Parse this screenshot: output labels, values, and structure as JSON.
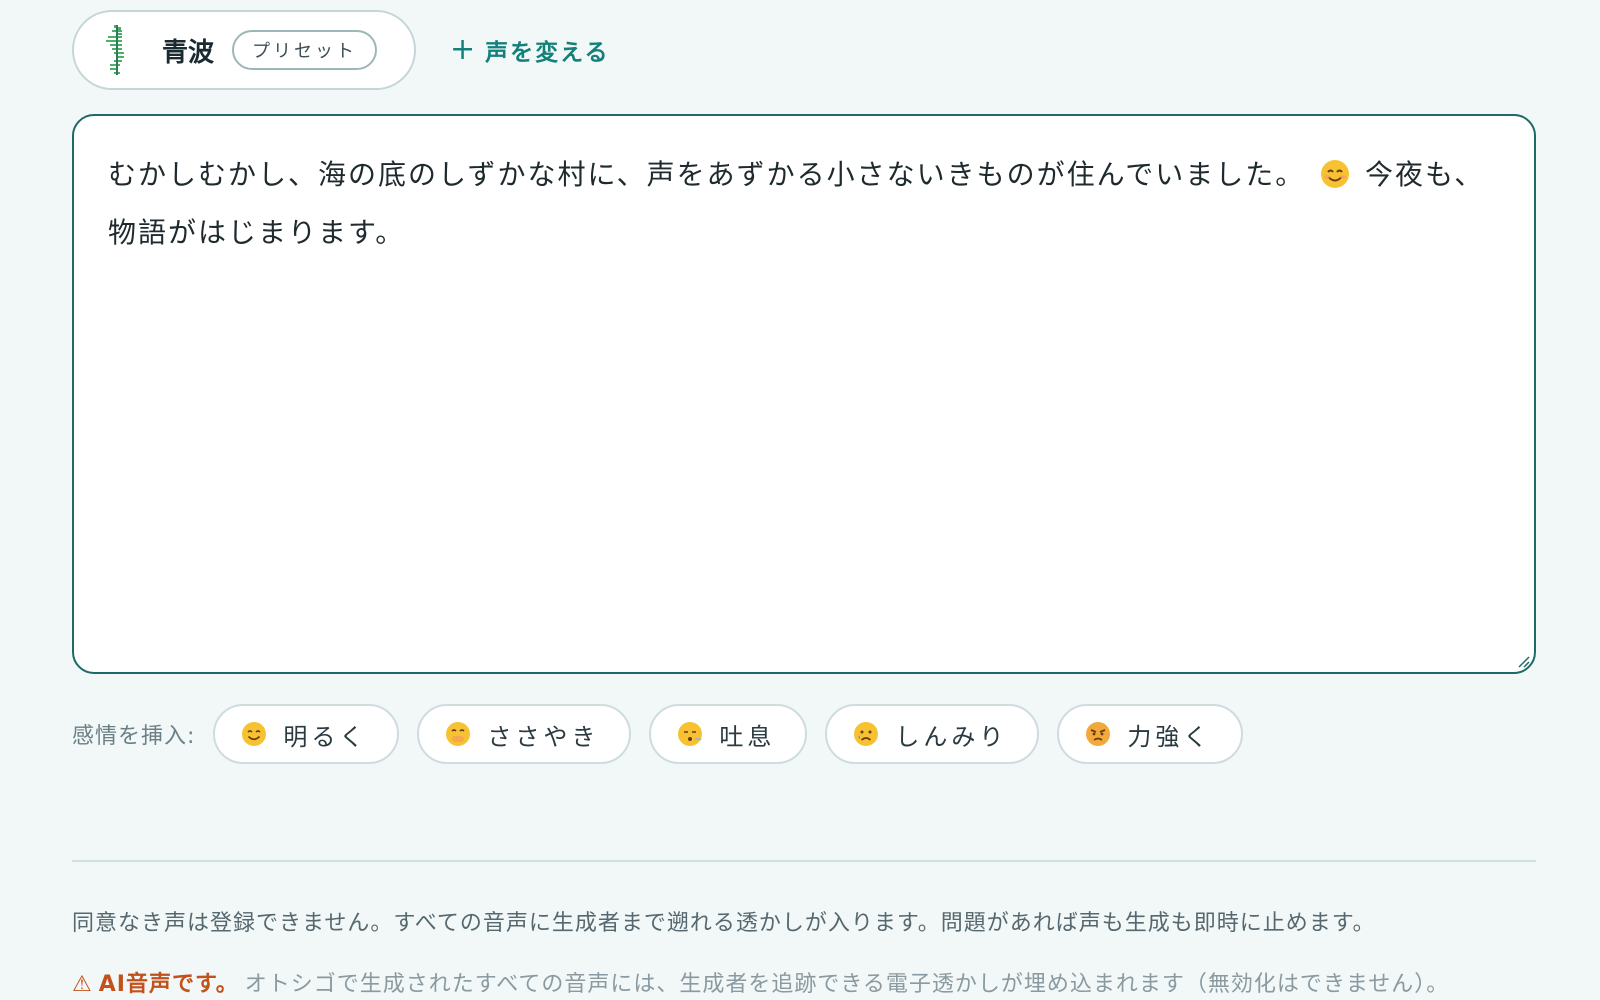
{
  "voice": {
    "name": "青波",
    "badge": "プリセット",
    "change_label": "声を変える",
    "change_icon": "plus-icon",
    "avatar_icon": "seahorse-icon"
  },
  "editor": {
    "text_before_emoji": "むかしむかし、海の底のしずかな村に、声をあずかる小さないきものが住んでいました。",
    "emoji": "smile-emoji",
    "text_after_emoji": "今夜も、物語がはじまります。"
  },
  "emotions": {
    "label": "感情を挿入:",
    "items": [
      {
        "label": "明るく",
        "icon": "smiling-face-icon"
      },
      {
        "label": "ささやき",
        "icon": "hand-over-mouth-icon"
      },
      {
        "label": "吐息",
        "icon": "exhale-face-icon"
      },
      {
        "label": "しんみり",
        "icon": "crying-face-icon"
      },
      {
        "label": "力強く",
        "icon": "angry-face-icon"
      }
    ]
  },
  "footer": {
    "consent": "同意なき声は登録できません。すべての音声に生成者まで遡れる透かしが入ります。問題があれば声も生成も即時に止めます。",
    "warning_icon": "⚠",
    "warning_title": "AI音声です。",
    "warning_text": "オトシゴで生成されたすべての音声には、生成者を追跡できる電子透かしが埋め込まれます（無効化はできません）。"
  },
  "colors": {
    "accent": "#14807a",
    "editor_border": "#1e6a66",
    "warning": "#c2511b",
    "background": "#f2f7f7"
  }
}
